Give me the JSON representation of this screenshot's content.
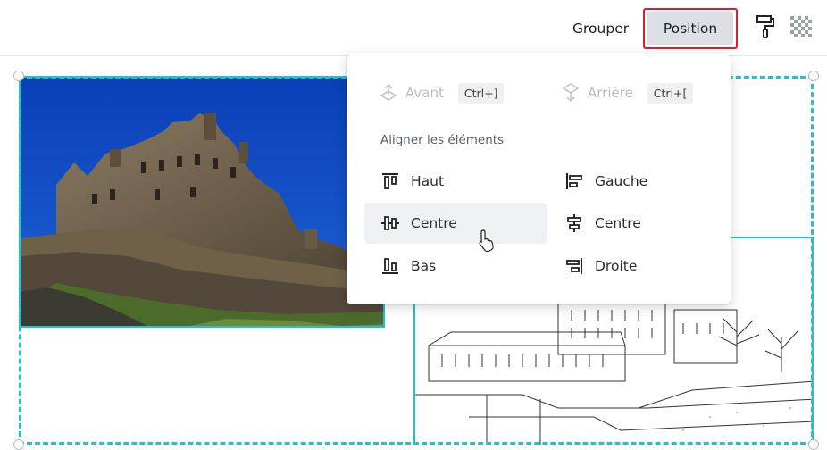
{
  "toolbar": {
    "grouper_label": "Grouper",
    "position_label": "Position",
    "icons": [
      "paint-roller-icon",
      "transparency-icon"
    ]
  },
  "dropdown": {
    "order": {
      "forward_label": "Avant",
      "forward_shortcut": "Ctrl+]",
      "backward_label": "Arrière",
      "backward_shortcut": "Ctrl+["
    },
    "section_title": "Aligner les éléments",
    "align_items": [
      {
        "label": "Haut",
        "icon": "align-top-icon"
      },
      {
        "label": "Gauche",
        "icon": "align-left-icon"
      },
      {
        "label": "Centre",
        "icon": "align-middle-icon",
        "hovered": true
      },
      {
        "label": "Centre",
        "icon": "align-center-icon"
      },
      {
        "label": "Bas",
        "icon": "align-bottom-icon"
      },
      {
        "label": "Droite",
        "icon": "align-right-icon"
      }
    ]
  },
  "colors": {
    "selection": "#1fc2d2",
    "highlight_border": "#d8202a",
    "hover_bg": "#eef0f3"
  }
}
